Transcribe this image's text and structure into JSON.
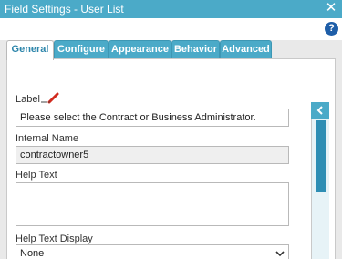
{
  "window": {
    "title": "Field Settings - User List",
    "close_symbol": "✕"
  },
  "help_symbol": "?",
  "tabs": [
    {
      "label": "General",
      "active": true
    },
    {
      "label": "Configure",
      "active": false
    },
    {
      "label": "Appearance",
      "active": false
    },
    {
      "label": "Behavior",
      "active": false
    },
    {
      "label": "Advanced",
      "active": false
    }
  ],
  "form": {
    "label_caption": "Label",
    "label_value": "Please select the Contract or Business Administrator.",
    "internal_name_caption": "Internal Name",
    "internal_name_value": "contractowner5",
    "help_text_caption": "Help Text",
    "help_text_value": "",
    "help_display_caption": "Help Text Display",
    "help_display_value": "None"
  },
  "colors": {
    "accent": "#4baac8",
    "help_icon": "#1e5ea8",
    "pencil": "#d12a1e",
    "panel_bg": "#e9e9e9"
  }
}
